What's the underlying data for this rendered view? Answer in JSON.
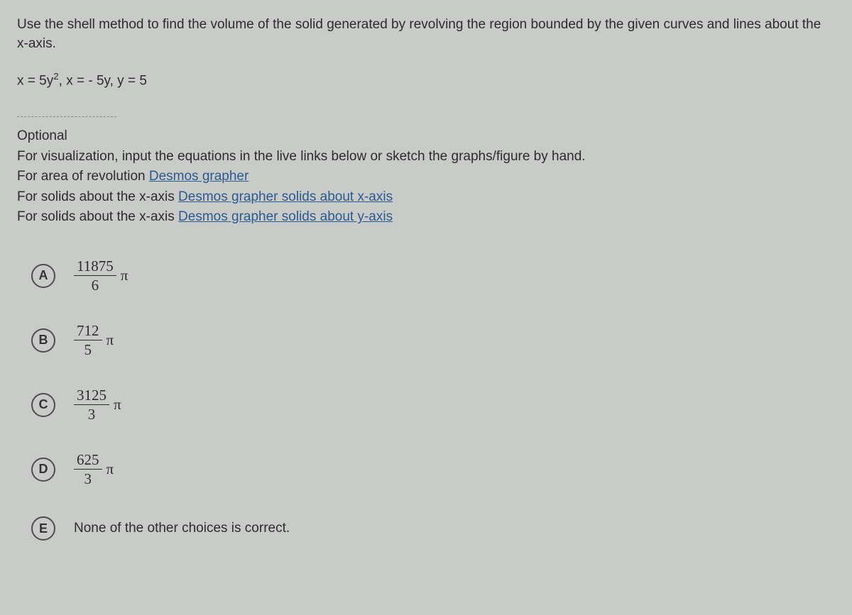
{
  "question": {
    "prompt": "Use the shell method to find the volume of the solid generated by revolving the region bounded by the given curves and lines about the x-axis.",
    "equation_prefix": "x = 5y",
    "equation_suffix": ", x = - 5y, y = 5"
  },
  "optional": {
    "heading": "Optional",
    "intro": "For visualization, input the equations in the live links below or sketch the graphs/figure by hand.",
    "area_label": "For area of revolution ",
    "area_link": "Desmos grapher",
    "x_label": "For solids about the x-axis ",
    "x_link": "Desmos grapher solids about x-axis",
    "y_label": "For solids about the x-axis ",
    "y_link": "Desmos grapher solids about y-axis"
  },
  "choices": {
    "a": {
      "letter": "A",
      "num": "11875",
      "den": "6",
      "pi": "π"
    },
    "b": {
      "letter": "B",
      "num": "712",
      "den": "5",
      "pi": "π"
    },
    "c": {
      "letter": "C",
      "num": "3125",
      "den": "3",
      "pi": "π"
    },
    "d": {
      "letter": "D",
      "num": "625",
      "den": "3",
      "pi": "π"
    },
    "e": {
      "letter": "E",
      "text": "None of the other choices is correct."
    }
  }
}
